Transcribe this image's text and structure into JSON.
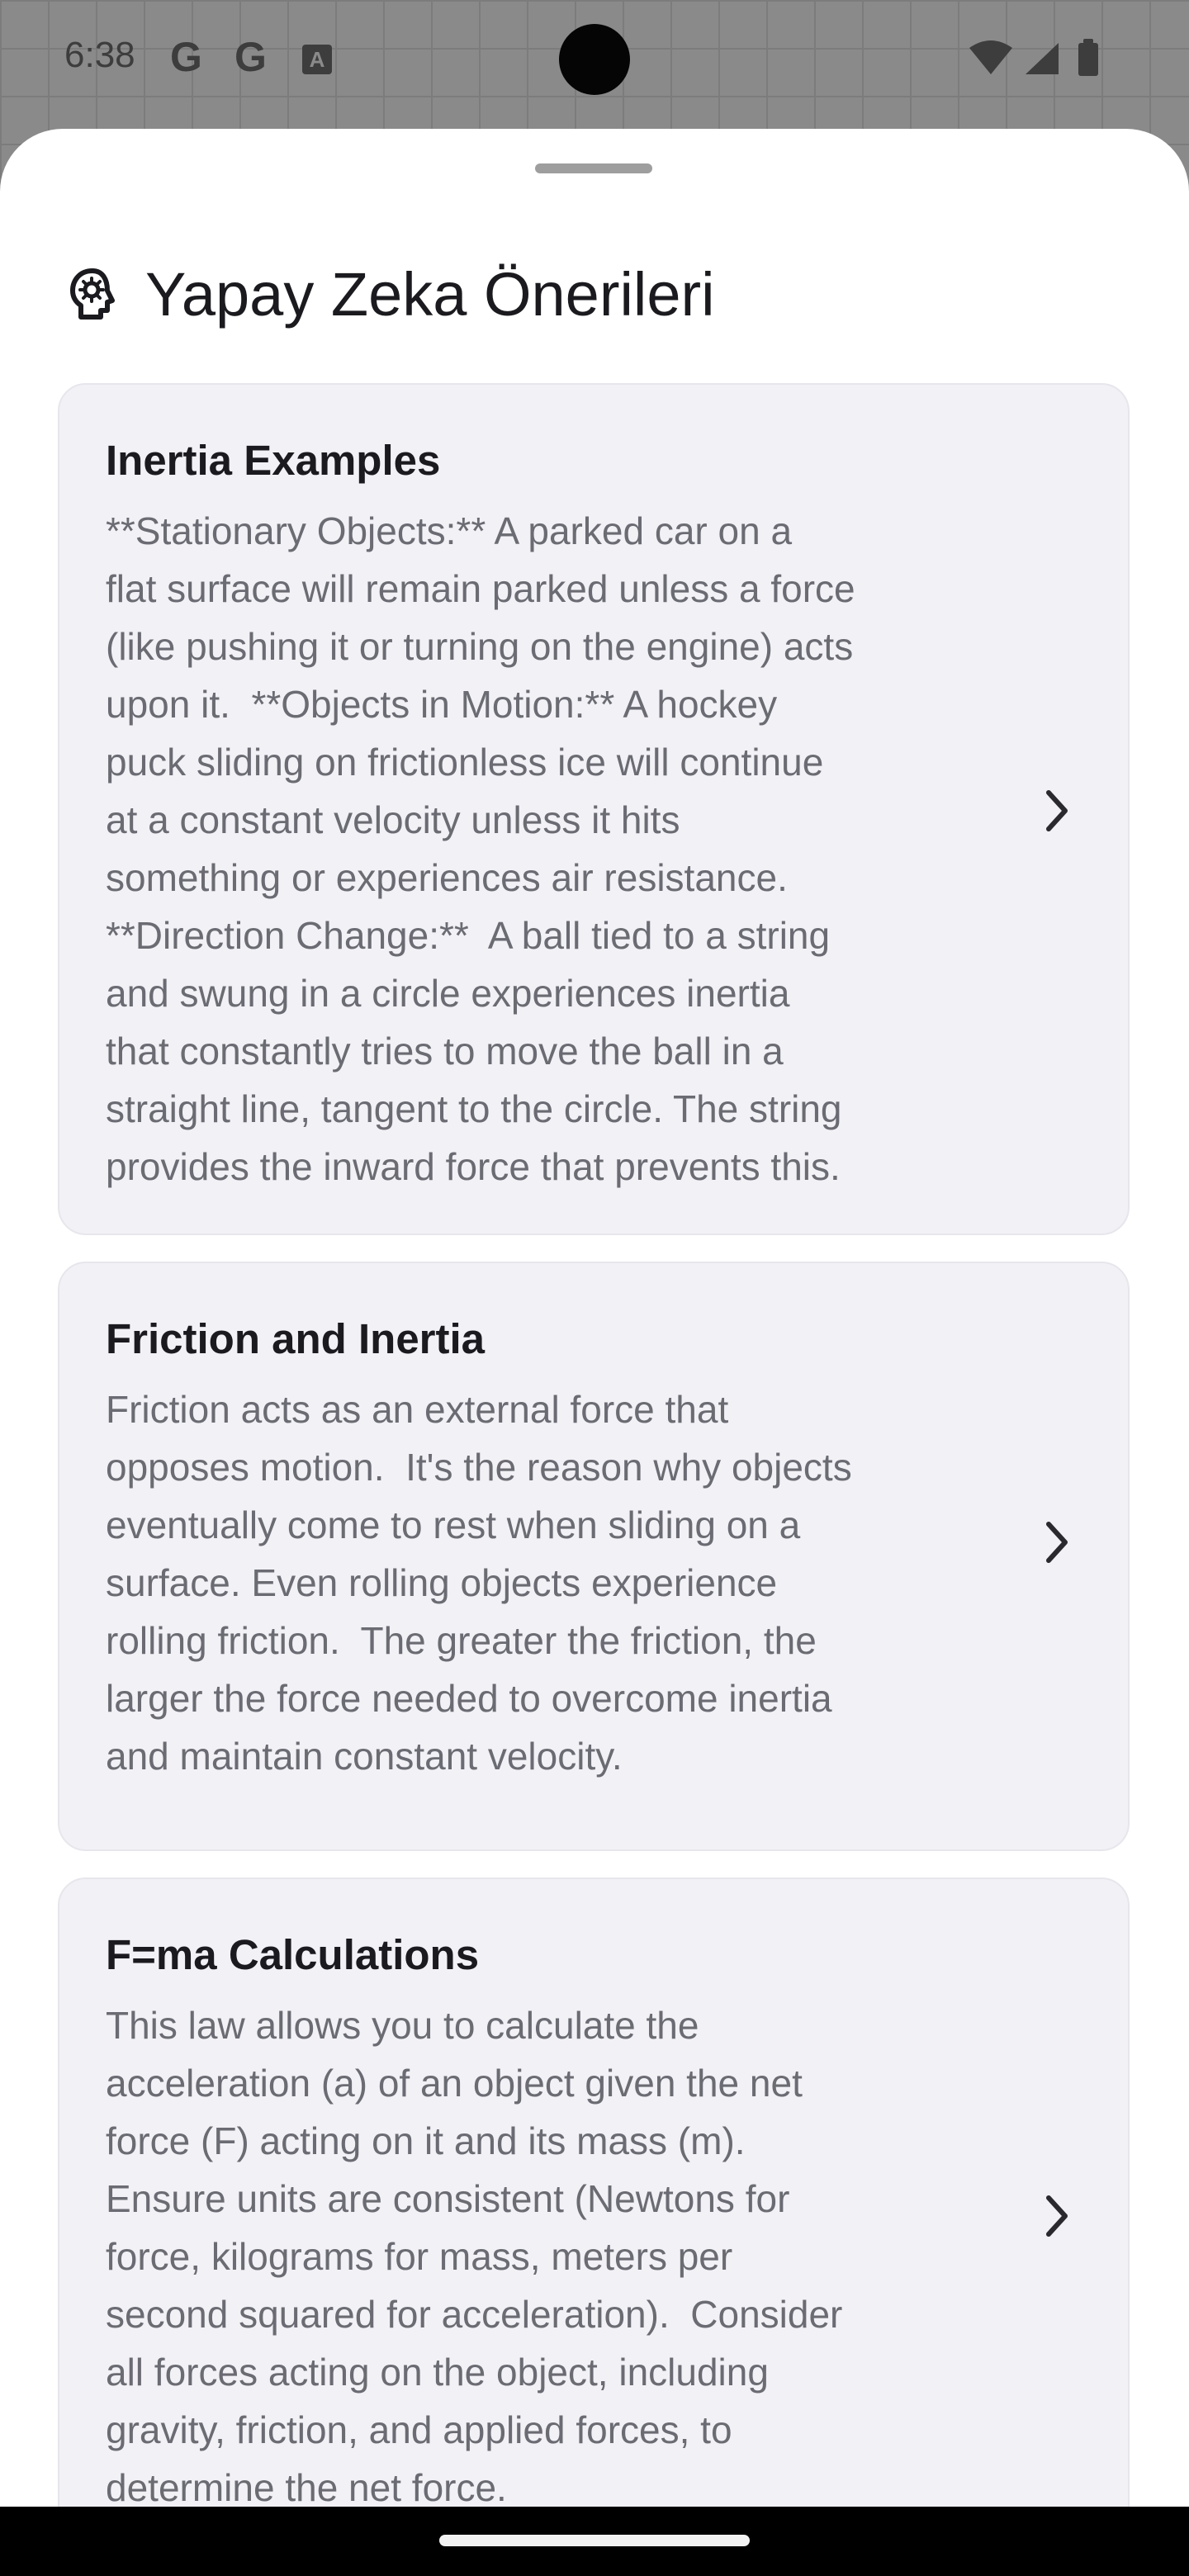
{
  "status_bar": {
    "time": "6:38",
    "notification_icons": [
      "google-icon",
      "google-icon",
      "font-a-icon"
    ],
    "g1": "G",
    "g2": "G",
    "a_badge": "A"
  },
  "sheet": {
    "title": "Yapay Zeka Önerileri",
    "title_icon": "brain-idea-icon"
  },
  "cards": [
    {
      "title": "Inertia Examples",
      "body": "**Stationary Objects:** A parked car on a\nflat surface will remain parked unless a force\n(like pushing it or turning on the engine) acts\nupon it.  **Objects in Motion:** A hockey\npuck sliding on frictionless ice will continue\nat a constant velocity unless it hits\nsomething or experiences air resistance.\n**Direction Change:**  A ball tied to a string\nand swung in a circle experiences inertia\nthat constantly tries to move the ball in a\nstraight line, tangent to the circle. The string\nprovides the inward force that prevents this."
    },
    {
      "title": "Friction and Inertia",
      "body": "Friction acts as an external force that\nopposes motion.  It's the reason why objects\neventually come to rest when sliding on a\nsurface. Even rolling objects experience\nrolling friction.  The greater the friction, the\nlarger the force needed to overcome inertia\nand maintain constant velocity."
    },
    {
      "title": "F=ma Calculations",
      "body": "This law allows you to calculate the\nacceleration (a) of an object given the net\nforce (F) acting on it and its mass (m).\nEnsure units are consistent (Newtons for\nforce, kilograms for mass, meters per\nsecond squared for acceleration).  Consider\nall forces acting on the object, including\ngravity, friction, and applied forces, to\ndetermine the net force."
    }
  ],
  "colors": {
    "card_background": "#f1f1f6",
    "title_text": "#1b1b1f",
    "body_text": "#6b6b73",
    "sheet_background": "#ffffff"
  }
}
